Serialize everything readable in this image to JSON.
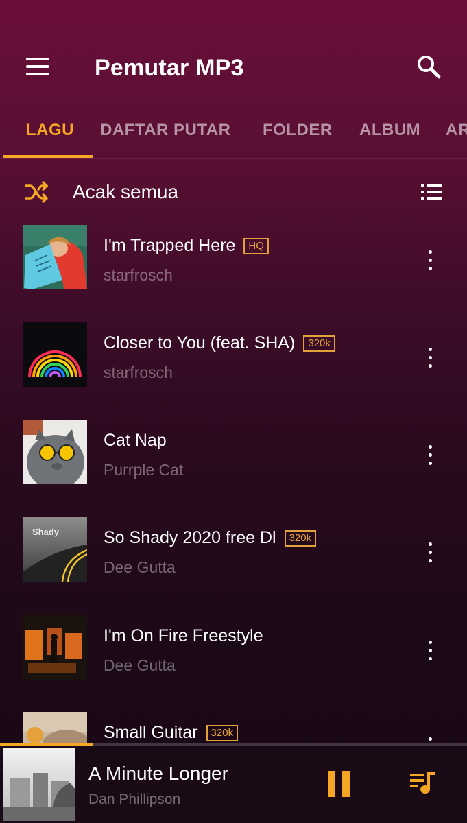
{
  "app": {
    "title": "Pemutar MP3"
  },
  "tabs": [
    {
      "label": "LAGU",
      "active": true
    },
    {
      "label": "DAFTAR PUTAR",
      "active": false
    },
    {
      "label": "FOLDER",
      "active": false
    },
    {
      "label": "ALBUM",
      "active": false
    },
    {
      "label": "AR",
      "active": false
    }
  ],
  "shuffle": {
    "label": "Acak semua"
  },
  "songs": [
    {
      "title": "I'm Trapped Here",
      "badge": "HQ",
      "artist": "starfrosch"
    },
    {
      "title": "Closer to You (feat. SHA)",
      "badge": "320k",
      "artist": "starfrosch"
    },
    {
      "title": "Cat Nap",
      "badge": "",
      "artist": "Purrple Cat"
    },
    {
      "title": "So Shady 2020 free Dl",
      "badge": "320k",
      "artist": "Dee Gutta",
      "art_text": "Shady"
    },
    {
      "title": "I'm On Fire Freestyle",
      "badge": "",
      "artist": "Dee Gutta"
    },
    {
      "title": "Small Guitar",
      "badge": "320k",
      "artist": ""
    }
  ],
  "now_playing": {
    "title": "A Minute Longer",
    "artist": "Dan Phillipson",
    "progress": 0.2
  },
  "colors": {
    "accent": "#f5a623",
    "badge": "#e3a13a",
    "background_top": "#6b0f3a",
    "background_bottom": "#170814"
  },
  "icons": {
    "menu": "menu-icon",
    "search": "search-icon",
    "shuffle": "shuffle-icon",
    "sort": "sort-list-icon",
    "more": "more-vertical-icon",
    "pause": "pause-icon",
    "queue": "queue-music-icon"
  }
}
